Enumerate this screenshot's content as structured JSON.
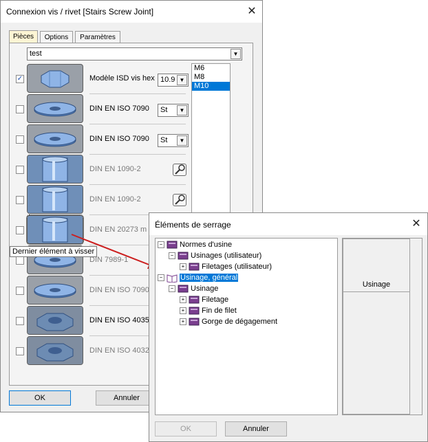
{
  "main": {
    "title": "Connexion vis / rivet [Stairs Screw Joint]",
    "tabs": [
      "Pièces",
      "Options",
      "Paramètres"
    ],
    "combo_value": "test",
    "rows": [
      {
        "label": "Modèle ISD vis hex",
        "checked": true,
        "dim": false,
        "combo": "10.9",
        "kind": "bolt"
      },
      {
        "label": "DIN EN ISO 7090",
        "checked": false,
        "dim": false,
        "combo": "St",
        "kind": "washer"
      },
      {
        "label": "DIN EN ISO 7090",
        "checked": false,
        "dim": false,
        "combo": "St",
        "kind": "washer"
      },
      {
        "label": "DIN EN 1090-2",
        "checked": false,
        "dim": true,
        "wrench": true,
        "kind": "hole"
      },
      {
        "label": "DIN EN 1090-2",
        "checked": false,
        "dim": true,
        "wrench": true,
        "kind": "hole"
      },
      {
        "label": "DIN EN 20273 m",
        "checked": false,
        "dim": true,
        "kind": "hole"
      },
      {
        "label": "DIN 7989-1",
        "checked": false,
        "dim": true,
        "kind": "washer"
      },
      {
        "label": "DIN EN ISO 7090",
        "checked": false,
        "dim": true,
        "kind": "washer"
      },
      {
        "label": "DIN EN ISO 4035",
        "checked": false,
        "dim": false,
        "kind": "nut"
      },
      {
        "label": "DIN EN ISO 4032",
        "checked": false,
        "dim": true,
        "kind": "nut"
      }
    ],
    "sizes": [
      "M6",
      "M8",
      "M10"
    ],
    "selected_size": "M10",
    "ok_label": "OK",
    "cancel_label": "Annuler",
    "tooltip": "Dernier élément à visser"
  },
  "secondary": {
    "title": "Éléments de serrage",
    "tree": {
      "n1": "Normes d'usine",
      "n2": "Usinages (utilisateur)",
      "n3": "Filetages (utilisateur)",
      "n4": "Usinage, général",
      "n5": "Usinage",
      "n6": "Filetage",
      "n7": "Fin de filet",
      "n8": "Gorge de dégagement"
    },
    "preview_caption": "Usinage",
    "ok_label": "OK",
    "cancel_label": "Annuler"
  },
  "colors": {
    "selection": "#0078d7",
    "book": "#7b3f8f",
    "arrow": "#cc1f1f"
  }
}
